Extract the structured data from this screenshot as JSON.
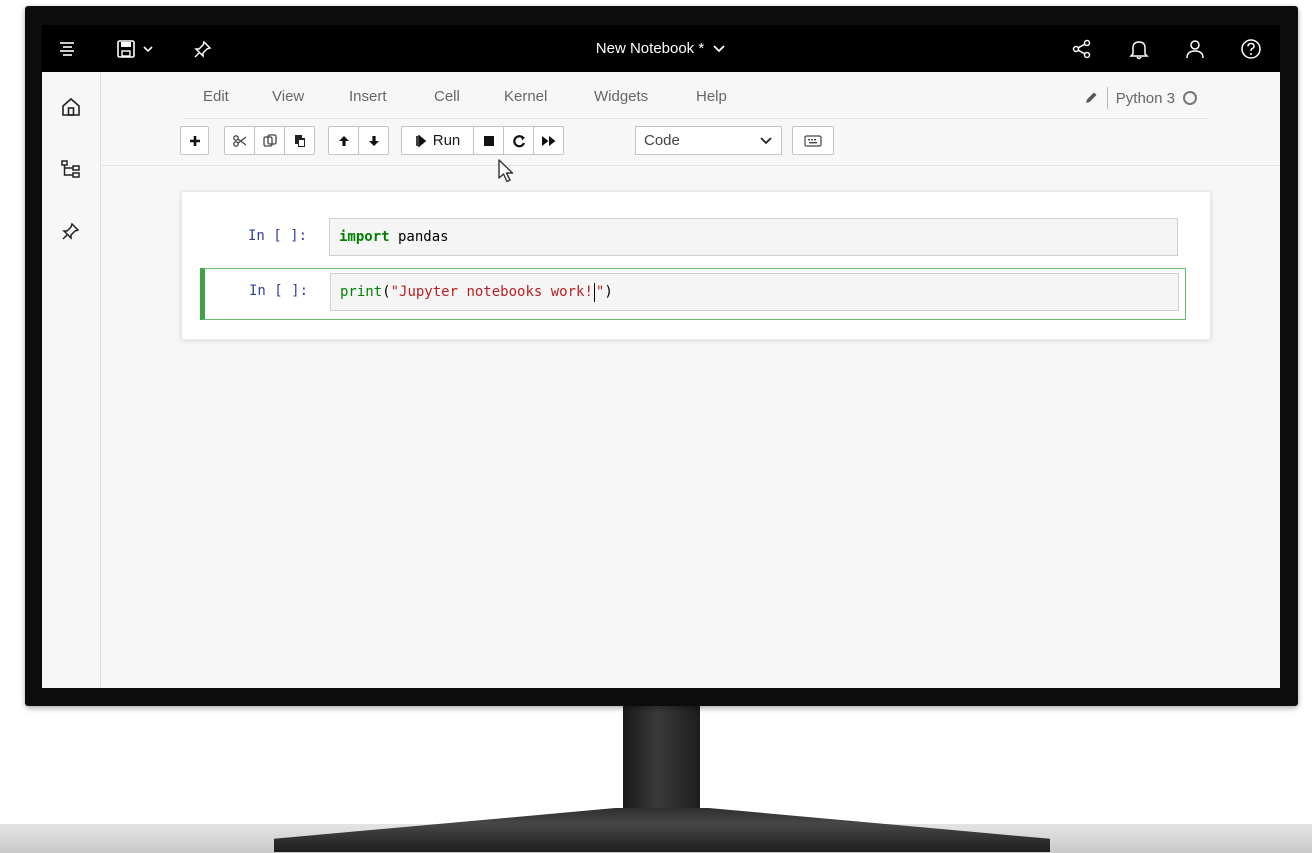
{
  "topbar": {
    "title": "New Notebook",
    "modified_marker": "*",
    "icons": {
      "menu": "hamburger-menu-icon",
      "save": "save-icon",
      "pin": "pin-icon",
      "share": "share-icon",
      "notifications": "bell-icon",
      "user": "user-icon",
      "help": "help-icon"
    }
  },
  "leftrail": {
    "items": [
      "home-icon",
      "hierarchy-icon",
      "pin-icon"
    ]
  },
  "menubar": {
    "items": [
      "Edit",
      "View",
      "Insert",
      "Cell",
      "Kernel",
      "Widgets",
      "Help"
    ],
    "kernel_name": "Python 3"
  },
  "toolbar": {
    "run_label": "Run",
    "cell_type_selected": "Code"
  },
  "cells": [
    {
      "prompt": "In [ ]:",
      "tokens": [
        {
          "text": "import",
          "kind": "kw"
        },
        {
          "text": " pandas",
          "kind": "ident"
        }
      ]
    },
    {
      "prompt": "In [ ]:",
      "selected": true,
      "tokens": [
        {
          "text": "print",
          "kind": "builtin"
        },
        {
          "text": "(",
          "kind": "paren"
        },
        {
          "text": "\"Jupyter notebooks work!",
          "kind": "str"
        },
        {
          "text": "\"",
          "kind": "str"
        },
        {
          "text": ")",
          "kind": "paren"
        }
      ]
    }
  ],
  "colors": {
    "topbar_bg": "#000000",
    "cell_selected_border": "#43a047",
    "prompt_color": "#303f9f",
    "string_color": "#ba2121",
    "keyword_color": "#008000"
  }
}
